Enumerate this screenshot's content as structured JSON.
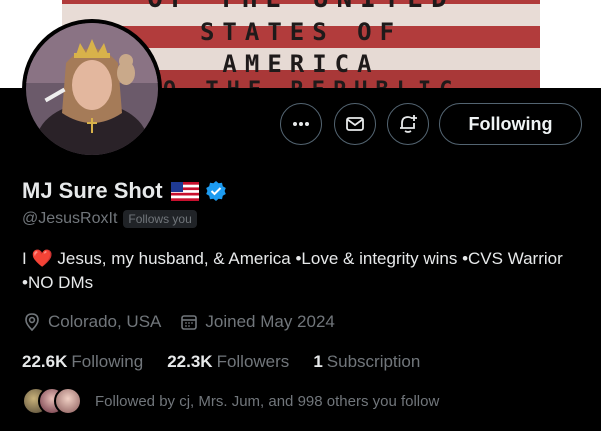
{
  "banner": {
    "line1": "OF THE UNITED",
    "line2": "STATES OF",
    "line3": "AMERICA",
    "line4": "TO THE REPUBLIC"
  },
  "profile": {
    "display_name": "MJ Sure Shot",
    "handle": "@JesusRoxIt",
    "follows_you_label": "Follows you",
    "bio_prefix": "I",
    "bio_heart": "❤️",
    "bio_rest": "Jesus, my husband, & America •Love & integrity wins •CVS Warrior •NO DMs",
    "location": "Colorado, USA",
    "joined": "Joined May 2024"
  },
  "actions": {
    "following_label": "Following",
    "more_icon": "more-icon",
    "message_icon": "envelope-icon",
    "notify_icon": "bell-plus-icon"
  },
  "stats": {
    "following_count": "22.6K",
    "following_label": "Following",
    "followers_count": "22.3K",
    "followers_label": "Followers",
    "subscription_count": "1",
    "subscription_label": "Subscription"
  },
  "followed_by": {
    "text": "Followed by cj, Mrs. Jum, and 998 others you follow"
  },
  "colors": {
    "background": "#000000",
    "primary_text": "#e7e9ea",
    "secondary_text": "#71767b",
    "border": "#536471",
    "verified_blue": "#1d9bf0",
    "heart_red": "#e0245e"
  }
}
